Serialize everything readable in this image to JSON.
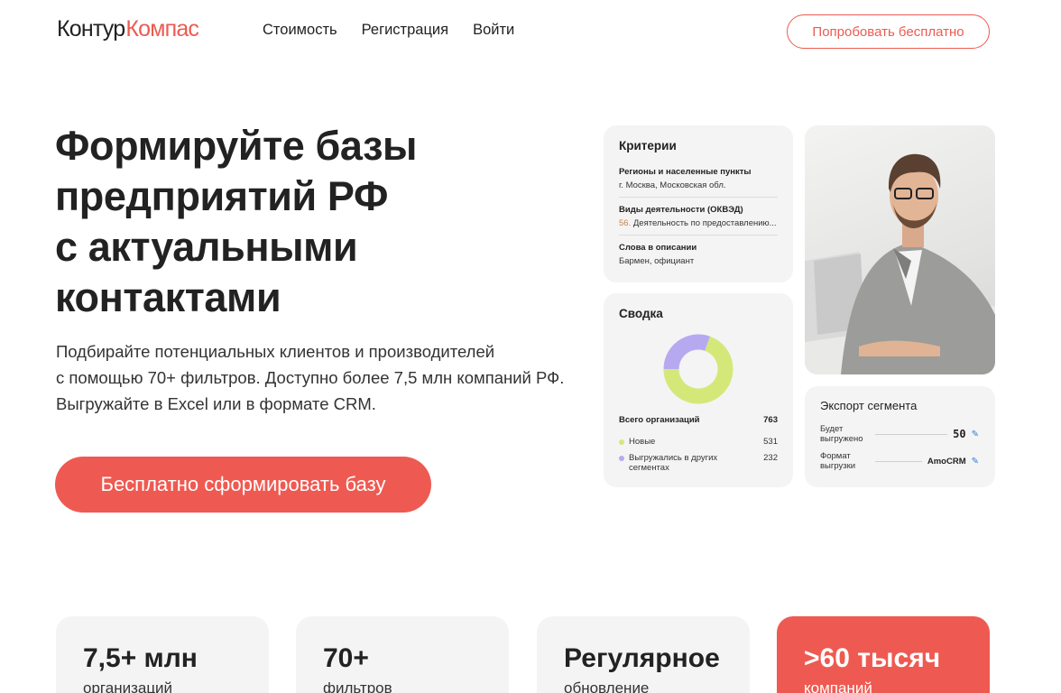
{
  "header": {
    "logo_part1": "Контур",
    "logo_part2": "Компас",
    "nav": [
      "Стоимость",
      "Регистрация",
      "Войти"
    ],
    "try_button": "Попробовать бесплатно"
  },
  "hero": {
    "title_lines": [
      "Формируйте базы",
      "предприятий РФ",
      "с актуальными",
      "контактами"
    ],
    "text_lines": [
      "Подбирайте потенциальных клиентов и производителей",
      "с помощью 70+ фильтров. Доступно более 7,5 млн компаний РФ.",
      "Выгружайте в Excel или в формате CRM."
    ],
    "cta": "Бесплатно сформировать базу"
  },
  "criteria": {
    "title": "Критерии",
    "items": [
      {
        "label": "Регионы и населенные пункты",
        "value": "г. Москва, Московская обл."
      },
      {
        "label": "Виды деятельности (ОКВЭД)",
        "code": "56.",
        "value": "Деятельность по предоставлению..."
      },
      {
        "label": "Слова в описании",
        "value": "Бармен, официант"
      }
    ]
  },
  "summary": {
    "title": "Сводка",
    "total_label": "Всего организаций",
    "total_value": "763",
    "rows": [
      {
        "label": "Новые",
        "value": "531",
        "color": "#d4e87a"
      },
      {
        "label": "Выгружались в других сегментах",
        "value": "232",
        "color": "#b7a9f0"
      }
    ]
  },
  "export": {
    "title": "Экспорт сегмента",
    "rows": [
      {
        "label": "Будет выгружено",
        "value": "50"
      },
      {
        "label": "Формат выгрузки",
        "value": "AmoCRM"
      }
    ]
  },
  "stats": [
    {
      "big": "7,5+ млн",
      "small": "организаций"
    },
    {
      "big": "70+",
      "small": "фильтров"
    },
    {
      "big": "Регулярное",
      "small": "обновление"
    },
    {
      "big": ">60 тысяч",
      "small": "компаний"
    }
  ],
  "colors": {
    "accent": "#ee5a51",
    "card_bg": "#f4f4f4",
    "donut_new": "#d4e87a",
    "donut_other": "#b7a9f0"
  }
}
